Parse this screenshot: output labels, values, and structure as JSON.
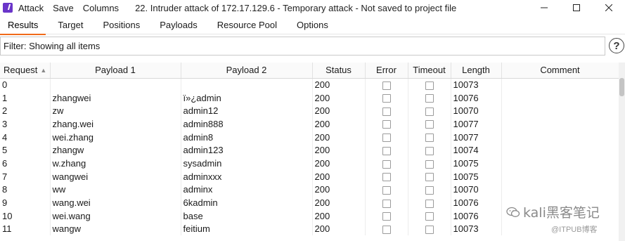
{
  "menu": {
    "attack": "Attack",
    "save": "Save",
    "columns": "Columns"
  },
  "window_title": "22. Intruder attack of 172.17.129.6 - Temporary attack - Not saved to project file",
  "tabs": [
    {
      "label": "Results"
    },
    {
      "label": "Target"
    },
    {
      "label": "Positions"
    },
    {
      "label": "Payloads"
    },
    {
      "label": "Resource Pool"
    },
    {
      "label": "Options"
    }
  ],
  "active_tab": "Results",
  "filter": {
    "text": "Filter: Showing all items"
  },
  "table": {
    "columns": [
      "Request",
      "Payload 1",
      "Payload 2",
      "Status",
      "Error",
      "Timeout",
      "Length",
      "Comment"
    ],
    "sorted_column": "Request",
    "rows": [
      {
        "request": "0",
        "payload1": "",
        "payload2": "",
        "status": "200",
        "error": false,
        "timeout": false,
        "length": "10073",
        "comment": ""
      },
      {
        "request": "1",
        "payload1": "zhangwei",
        "payload2": "ï»¿admin",
        "status": "200",
        "error": false,
        "timeout": false,
        "length": "10076",
        "comment": ""
      },
      {
        "request": "2",
        "payload1": "zw",
        "payload2": "admin12",
        "status": "200",
        "error": false,
        "timeout": false,
        "length": "10070",
        "comment": ""
      },
      {
        "request": "3",
        "payload1": "zhang.wei",
        "payload2": "admin888",
        "status": "200",
        "error": false,
        "timeout": false,
        "length": "10077",
        "comment": ""
      },
      {
        "request": "4",
        "payload1": "wei.zhang",
        "payload2": "admin8",
        "status": "200",
        "error": false,
        "timeout": false,
        "length": "10077",
        "comment": ""
      },
      {
        "request": "5",
        "payload1": "zhangw",
        "payload2": "admin123",
        "status": "200",
        "error": false,
        "timeout": false,
        "length": "10074",
        "comment": ""
      },
      {
        "request": "6",
        "payload1": "w.zhang",
        "payload2": "sysadmin",
        "status": "200",
        "error": false,
        "timeout": false,
        "length": "10075",
        "comment": ""
      },
      {
        "request": "7",
        "payload1": "wangwei",
        "payload2": "adminxxx",
        "status": "200",
        "error": false,
        "timeout": false,
        "length": "10075",
        "comment": ""
      },
      {
        "request": "8",
        "payload1": "ww",
        "payload2": "adminx",
        "status": "200",
        "error": false,
        "timeout": false,
        "length": "10070",
        "comment": ""
      },
      {
        "request": "9",
        "payload1": "wang.wei",
        "payload2": "6kadmin",
        "status": "200",
        "error": false,
        "timeout": false,
        "length": "10076",
        "comment": ""
      },
      {
        "request": "10",
        "payload1": "wei.wang",
        "payload2": "base",
        "status": "200",
        "error": false,
        "timeout": false,
        "length": "10076",
        "comment": ""
      },
      {
        "request": "11",
        "payload1": "wangw",
        "payload2": "feitium",
        "status": "200",
        "error": false,
        "timeout": false,
        "length": "10073",
        "comment": ""
      }
    ]
  },
  "watermark": {
    "line1": "kali黑客笔记",
    "line2": "@ITPUB博客"
  },
  "colors": {
    "app_icon": "#6a35c9",
    "active_tab_underline": "#f06a1a"
  }
}
